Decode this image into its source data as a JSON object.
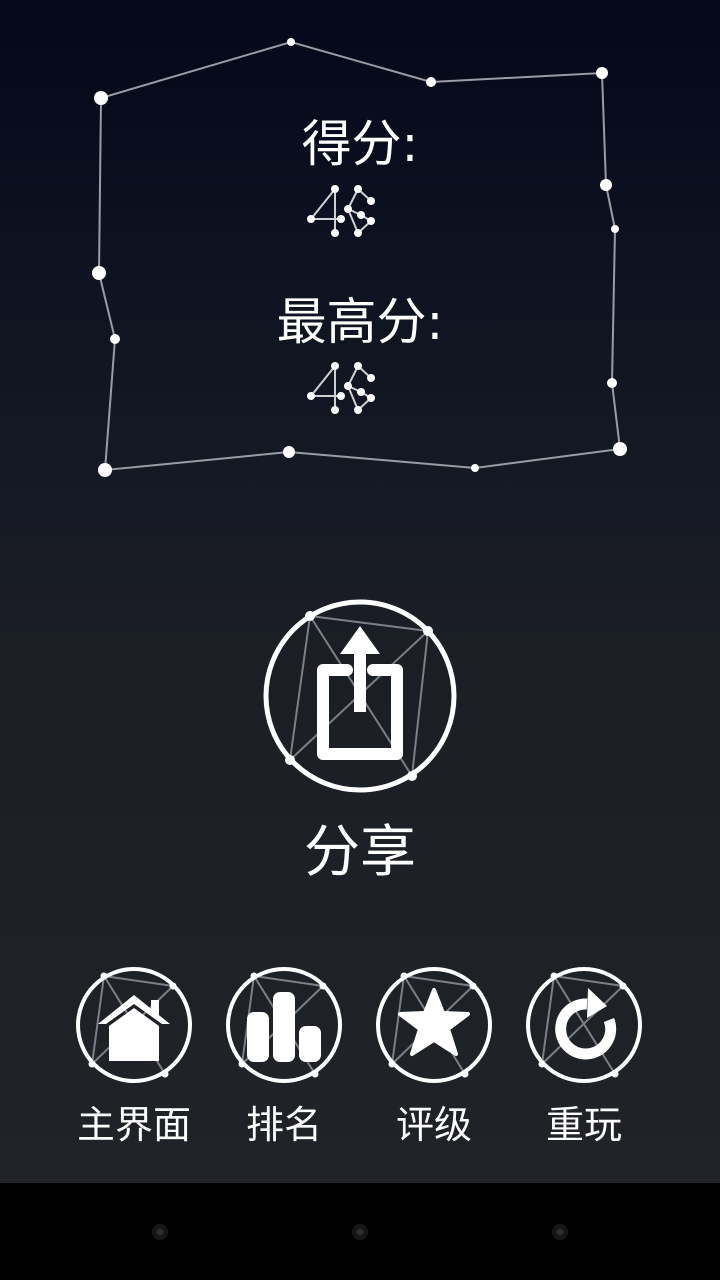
{
  "score": {
    "label": "得分:",
    "value": "46"
  },
  "best": {
    "label": "最高分:",
    "value": "46"
  },
  "share": {
    "label": "分享",
    "icon": "share-icon"
  },
  "nav_buttons": [
    {
      "label": "主界面",
      "icon": "home-icon"
    },
    {
      "label": "排名",
      "icon": "bar-chart-icon"
    },
    {
      "label": "评级",
      "icon": "star-icon"
    },
    {
      "label": "重玩",
      "icon": "replay-icon"
    }
  ],
  "colors": {
    "background_top": "#03081a",
    "background_bottom": "#202327",
    "foreground": "#ffffff",
    "line": "#9a9ca4"
  },
  "system_nav": {
    "buttons": [
      "back",
      "home",
      "recent"
    ]
  }
}
